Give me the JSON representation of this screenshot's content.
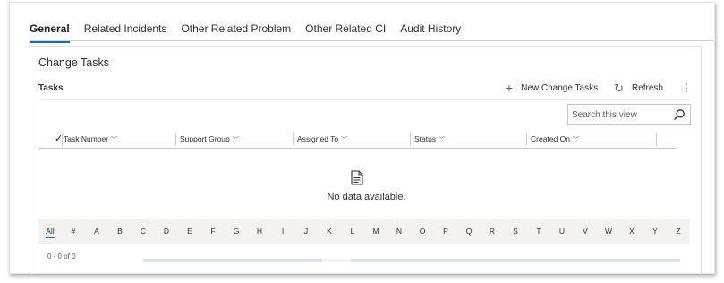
{
  "tabs": [
    {
      "label": "General",
      "active": true
    },
    {
      "label": "Related Incidents",
      "active": false
    },
    {
      "label": "Other Related Problem",
      "active": false
    },
    {
      "label": "Other Related CI",
      "active": false
    },
    {
      "label": "Audit History",
      "active": false
    }
  ],
  "section": {
    "title": "Change Tasks",
    "subgrid_title": "Tasks",
    "commands": {
      "new_label": "New Change Tasks",
      "new_icon": "plus-icon",
      "refresh_label": "Refresh",
      "refresh_icon": "refresh-icon",
      "more_icon": "more-vertical-icon"
    },
    "search": {
      "placeholder": "Search this view",
      "value": "",
      "icon": "search-icon"
    },
    "columns": [
      "Task Number",
      "Support Group",
      "Assigned To",
      "Status",
      "Created On"
    ],
    "empty_message": "No data available.",
    "jump_letters": [
      "All",
      "#",
      "A",
      "B",
      "C",
      "D",
      "E",
      "F",
      "G",
      "H",
      "I",
      "J",
      "K",
      "L",
      "M",
      "N",
      "O",
      "P",
      "Q",
      "R",
      "S",
      "T",
      "U",
      "V",
      "W",
      "X",
      "Y",
      "Z"
    ],
    "record_count": "0 - 0 of 0"
  },
  "colors": {
    "accent": "#0f6cbd",
    "border": "#e1dfdd",
    "jumpbar_bg": "#f3f2f1"
  }
}
